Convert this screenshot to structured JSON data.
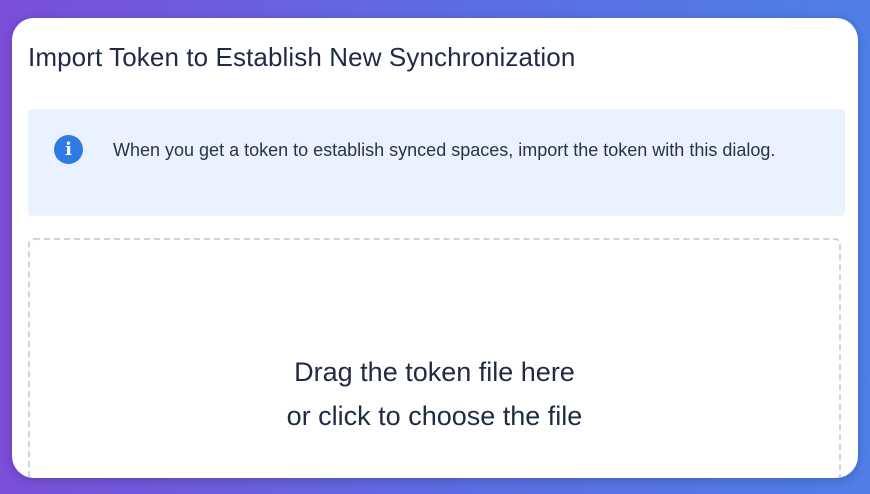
{
  "dialog": {
    "title": "Import Token to Establish New Synchronization"
  },
  "info_banner": {
    "icon": "info-icon",
    "icon_glyph": "i",
    "icon_color": "#2f7be6",
    "background_color": "#e9f2fe",
    "text": "When you get a token to establish synced spaces, import the token with this dialog."
  },
  "dropzone": {
    "line1": "Drag the token file here",
    "line2": "or click to choose the file"
  },
  "colors": {
    "text_primary": "#1e2a47",
    "dropzone_border": "#cfd3da"
  }
}
